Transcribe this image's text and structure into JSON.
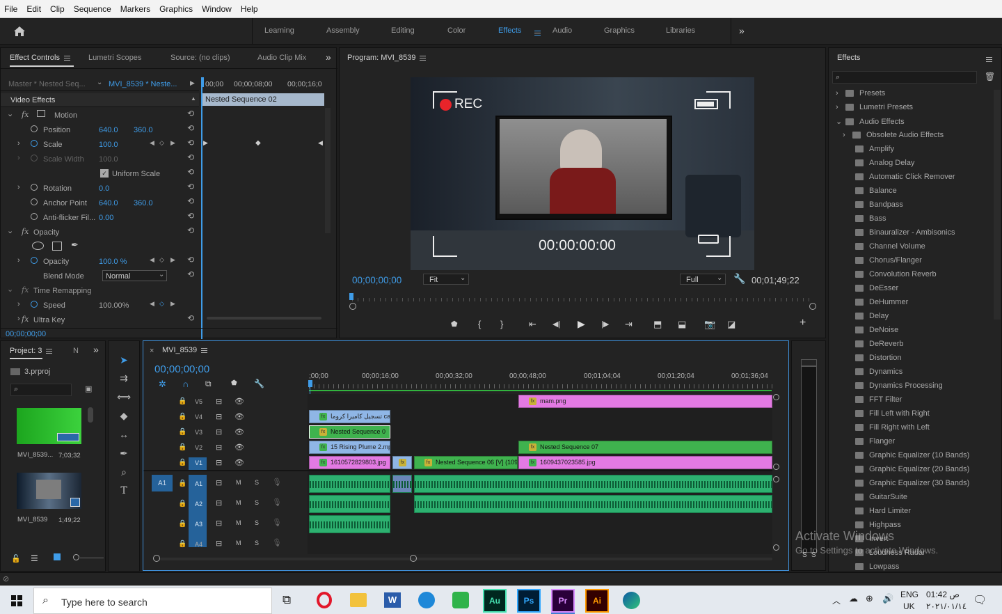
{
  "menubar": [
    "File",
    "Edit",
    "Clip",
    "Sequence",
    "Markers",
    "Graphics",
    "Window",
    "Help"
  ],
  "workspaces": [
    "Learning",
    "Assembly",
    "Editing",
    "Color",
    "Effects",
    "Audio",
    "Graphics",
    "Libraries"
  ],
  "active_workspace": "Effects",
  "effect_controls": {
    "tabs": [
      "Effect Controls",
      "Lumetri Scopes",
      "Source: (no clips)",
      "Audio Clip Mix"
    ],
    "master": "Master * Nested Seq...",
    "clip": "MVI_8539 * Neste...",
    "ruler": [
      "00;00",
      "00;00;08;00",
      "00;00;16;0"
    ],
    "nested_label": "Nested Sequence 02",
    "section": "Video Effects",
    "motion": "Motion",
    "position_label": "Position",
    "position_x": "640.0",
    "position_y": "360.0",
    "scale_label": "Scale",
    "scale_val": "100.0",
    "scale_width_label": "Scale Width",
    "scale_width_val": "100.0",
    "uniform_label": "Uniform Scale",
    "rotation_label": "Rotation",
    "rotation_val": "0.0",
    "anchor_label": "Anchor Point",
    "anchor_x": "640.0",
    "anchor_y": "360.0",
    "flicker_label": "Anti-flicker Fil...",
    "flicker_val": "0.00",
    "opacity_section": "Opacity",
    "opacity_label": "Opacity",
    "opacity_val": "100.0 %",
    "blend_label": "Blend Mode",
    "blend_val": "Normal",
    "time_remap": "Time Remapping",
    "speed_label": "Speed",
    "speed_val": "100.00%",
    "ultra": "Ultra Key",
    "timecode": "00;00;00;00"
  },
  "program": {
    "title": "Program: MVI_8539",
    "rec": "REC",
    "overlay_tc": "00:00:00:00",
    "timecode": "00;00;00;00",
    "fit": "Fit",
    "quality": "Full",
    "duration": "00;01;49;22"
  },
  "project": {
    "tabs": [
      "Project: 3",
      "N"
    ],
    "file": "3.prproj",
    "items": [
      {
        "name": "MVI_8539...",
        "duration": "7;03;32"
      },
      {
        "name": "MVI_8539",
        "duration": "1;49;22"
      }
    ]
  },
  "timeline": {
    "tab": "MVI_8539",
    "timecode": "00;00;00;00",
    "ruler": [
      ";00;00",
      "00;00;16;00",
      "00;00;32;00",
      "00;00;48;00",
      "00;01;04;04",
      "00;01;20;04",
      "00;01;36;04"
    ],
    "video_tracks": [
      "V5",
      "V4",
      "V3",
      "V2",
      "V1"
    ],
    "audio_tracks": [
      "A1",
      "A2",
      "A3",
      "A4"
    ],
    "source_patch": "A1",
    "mute": "M",
    "solo": "S",
    "clips": {
      "mam": "mam.png",
      "v4": "تسجيل كاميرا كروما ca",
      "v3": "Nested Sequence 0",
      "v2a": "15 Rising Plume 2.mp",
      "v2b": "Nested Sequence 07",
      "v1a": "1610572829803.jpg",
      "v1b": "Nested Sequence 06 [V] (109",
      "v1c": "1609437023585.jpg"
    }
  },
  "effects": {
    "title": "Effects",
    "folders": [
      "Presets",
      "Lumetri Presets",
      "Audio Effects",
      "Obsolete Audio Effects"
    ],
    "items": [
      "Amplify",
      "Analog Delay",
      "Automatic Click Remover",
      "Balance",
      "Bandpass",
      "Bass",
      "Binauralizer - Ambisonics",
      "Channel Volume",
      "Chorus/Flanger",
      "Convolution Reverb",
      "DeEsser",
      "DeHummer",
      "Delay",
      "DeNoise",
      "DeReverb",
      "Distortion",
      "Dynamics",
      "Dynamics Processing",
      "FFT Filter",
      "Fill Left with Right",
      "Fill Right with Left",
      "Flanger",
      "Graphic Equalizer (10 Bands)",
      "Graphic Equalizer (20 Bands)",
      "Graphic Equalizer (30 Bands)",
      "GuitarSuite",
      "Hard Limiter",
      "Highpass",
      "Invert",
      "Loudness Radar",
      "Lowpass"
    ]
  },
  "watermark": {
    "line1": "Activate Windows",
    "line2": "Go to Settings to activate Windows."
  },
  "meter": {
    "labels": [
      "S",
      "S"
    ]
  },
  "taskbar": {
    "search": "Type here to search",
    "apps": [
      "Au",
      "Ps",
      "Pr",
      "Ai"
    ],
    "lang": "ENG",
    "region": "UK",
    "time": "01:42 ص",
    "date": "٢٠٢١/٠١/١٤"
  },
  "colors": {
    "accent": "#3f9ce8",
    "video_clip_pink": "#e37ae3",
    "video_clip_green": "#3fb24e",
    "audio_clip": "#2db170"
  }
}
